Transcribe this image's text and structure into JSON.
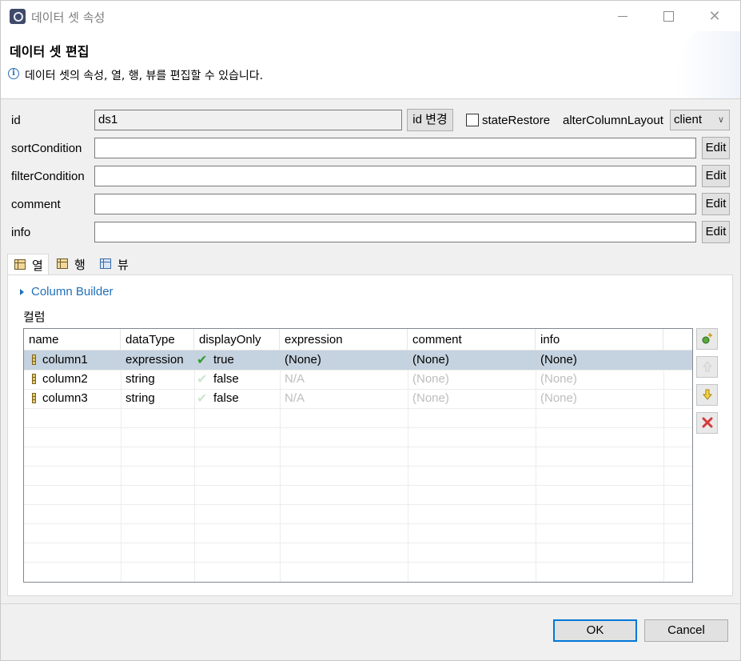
{
  "window": {
    "title": "데이터 셋 속성",
    "minimize": "—",
    "maximize": "☐",
    "close": "✕"
  },
  "header": {
    "title": "데이터 셋 편집",
    "info_icon": "info-icon",
    "description": "데이터 셋의 속성, 열, 행, 뷰를 편집할 수 있습니다."
  },
  "form": {
    "id_label": "id",
    "id_value": "ds1",
    "id_change_button": "id 변경",
    "state_restore_label": "stateRestore",
    "state_restore_checked": false,
    "alter_column_layout_label": "alterColumnLayout",
    "alter_column_layout_value": "client",
    "sort_condition_label": "sortCondition",
    "filter_condition_label": "filterCondition",
    "comment_label": "comment",
    "info_label": "info",
    "edit_button": "Edit"
  },
  "tabs": [
    {
      "label": "열",
      "active": true
    },
    {
      "label": "행",
      "active": false
    },
    {
      "label": "뷰",
      "active": false
    }
  ],
  "column_builder": "Column Builder",
  "section_label": "컬럼",
  "table": {
    "headers": [
      "name",
      "dataType",
      "displayOnly",
      "expression",
      "comment",
      "info"
    ],
    "rows": [
      {
        "name": "column1",
        "dataType": "expression",
        "displayOnly": "true",
        "expression": "(None)",
        "comment": "(None)",
        "info": "(None)",
        "selected": true
      },
      {
        "name": "column2",
        "dataType": "string",
        "displayOnly": "false",
        "expression": "N/A",
        "comment": "(None)",
        "info": "(None)",
        "selected": false
      },
      {
        "name": "column3",
        "dataType": "string",
        "displayOnly": "false",
        "expression": "N/A",
        "comment": "(None)",
        "info": "(None)",
        "selected": false
      }
    ]
  },
  "side_buttons": {
    "add": "add-column-icon",
    "up": "move-up-icon",
    "down": "move-down-icon",
    "delete": "delete-icon"
  },
  "footer": {
    "ok": "OK",
    "cancel": "Cancel"
  }
}
